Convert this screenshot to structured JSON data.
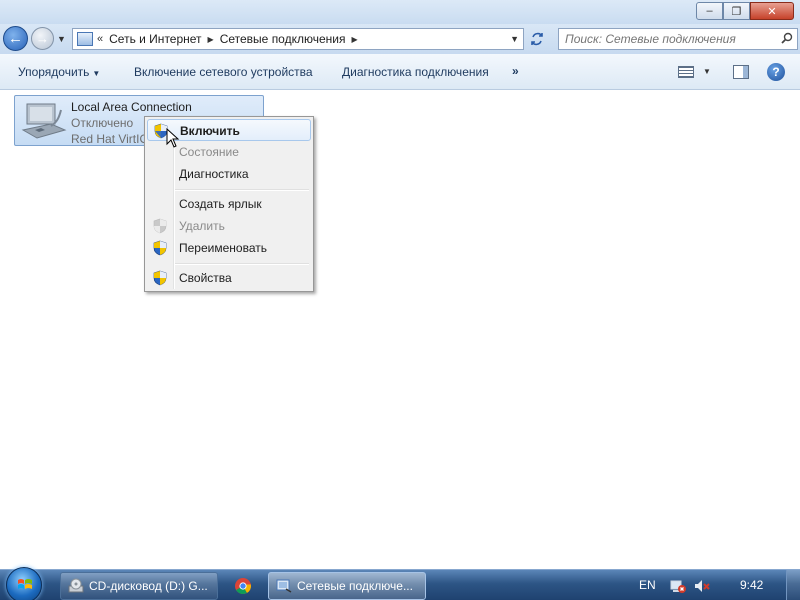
{
  "window": {
    "minimize": "–",
    "maximize": "❐",
    "close": "✕"
  },
  "nav": {
    "back_symbol": "←",
    "forward_symbol": "→",
    "breadcrumb_overflow": "«",
    "breadcrumbs": [
      "Сеть и Интернет",
      "Сетевые подключения"
    ],
    "search_placeholder": "Поиск: Сетевые подключения"
  },
  "toolbar": {
    "organize": "Упорядочить",
    "enable_device": "Включение сетевого устройства",
    "diagnose": "Диагностика подключения",
    "more": "»",
    "help": "?"
  },
  "connection": {
    "name": "Local Area Connection",
    "status": "Отключено",
    "device": "Red Hat VirtIO"
  },
  "context_menu": {
    "items": [
      {
        "label": "Включить",
        "icon": "uac-shield-icon",
        "default": true,
        "enabled": true
      },
      {
        "label": "Состояние",
        "icon": "",
        "enabled": false
      },
      {
        "label": "Диагностика",
        "icon": "",
        "enabled": true
      },
      {
        "label": "Создать ярлык",
        "icon": "",
        "enabled": true
      },
      {
        "label": "Удалить",
        "icon": "uac-shield-icon",
        "enabled": false
      },
      {
        "label": "Переименовать",
        "icon": "uac-shield-icon",
        "enabled": true
      },
      {
        "label": "Свойства",
        "icon": "uac-shield-icon",
        "enabled": true
      }
    ]
  },
  "taskbar": {
    "items": [
      {
        "label": "CD-дисковод (D:) G...",
        "icon": "cd-drive-icon",
        "active": false
      },
      {
        "label": "",
        "icon": "chrome-icon",
        "active": false
      },
      {
        "label": "Сетевые подключе...",
        "icon": "network-connections-icon",
        "active": true
      }
    ],
    "language": "EN",
    "clock": "9:42"
  },
  "colors": {
    "accent": "#2761b8",
    "selection": "#c6dcf4",
    "taskbar": "#2d5585"
  }
}
